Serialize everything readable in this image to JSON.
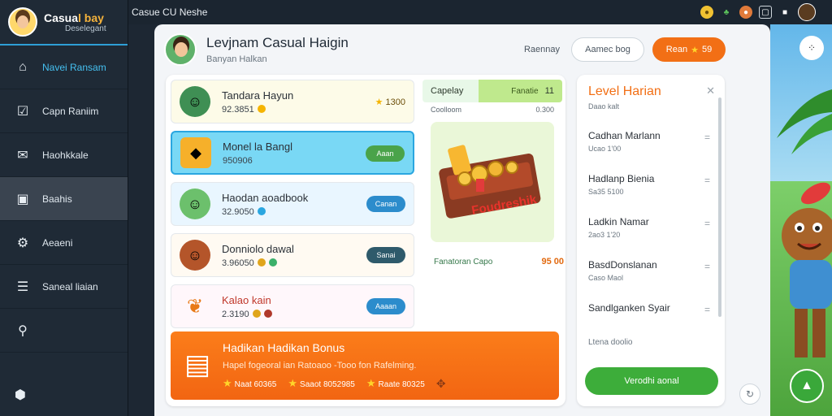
{
  "app": {
    "brand_name_1": "Casua",
    "brand_name_2": "l bay",
    "brand_sub": "Deselegant",
    "window_title": "Casue CU Neshe"
  },
  "sidebar": {
    "items": [
      {
        "label": "Navei Ransam",
        "icon": "home-icon"
      },
      {
        "label": "Capn Raniim",
        "icon": "checklist-icon"
      },
      {
        "label": "Haohkkale",
        "icon": "mail-icon"
      },
      {
        "label": "Baahis",
        "icon": "bag-icon"
      },
      {
        "label": "Aeaeni",
        "icon": "gear-icon"
      },
      {
        "label": "Saneal liaian",
        "icon": "list-icon"
      }
    ],
    "search_icon": "search-icon",
    "bottom_icon": "box-icon"
  },
  "header": {
    "user_name": "Levjnam Casual Haigin",
    "user_sub": "Banyan Halkan",
    "link": "Raennay",
    "outline_button": "Aamec bog",
    "orange_button": "Rean",
    "orange_value": "59"
  },
  "quests": [
    {
      "title": "Tandara Hayun",
      "value": "92.3851",
      "reward": "1300",
      "icon": "avatar-icon",
      "bg": "#fdfbe8"
    },
    {
      "title": "Monel la Bangl",
      "value": "950906",
      "button": "Aaan",
      "button_color": "#4aa34a",
      "icon": "gold-icon",
      "bg": "#79d8f5"
    },
    {
      "title": "Haodan aoadbook",
      "value": "32.9050",
      "button": "Canan",
      "button_color": "#2c8ccc",
      "icon": "avatar-icon",
      "bg": "#e9f6ff"
    },
    {
      "title": "Donniolo dawal",
      "value": "3.96050",
      "button": "Sanai",
      "button_color": "#2e5a6b",
      "icon": "avatar-icon",
      "bg": "#fffaf2"
    },
    {
      "title": "Kalao kain",
      "value": "2.3190",
      "button": "Aaaan",
      "button_color": "#2c8ccc",
      "icon": "fruit-icon",
      "bg": "#fff7fb"
    }
  ],
  "chest": {
    "title": "Capelay",
    "title_right": "Fanatie",
    "title_num": "11",
    "sub_left": "Coolloom",
    "sub_right": "0.300",
    "art_label": "Foudreshik",
    "foot_label": "Fanatoran Capo",
    "foot_value": "95 00"
  },
  "bonus": {
    "title": "Hadikan Hadikan Bonus",
    "desc": "Hapel fogeoral ian Ratoaoo -Tooo fon Rafelming.",
    "items": [
      "Naat 60365",
      "Saaot 8052985",
      "Raate 80325"
    ]
  },
  "level": {
    "title": "Level Harian",
    "sub": "Daao kalt",
    "items": [
      {
        "name": "Cadhan Marlann",
        "sub": "Ucao 1'00"
      },
      {
        "name": "Hadlanp Bienia",
        "sub": "Sa35 5100"
      },
      {
        "name": "Ladkin Namar",
        "sub": "2ao3 1'20"
      },
      {
        "name": "BasdDonslanan",
        "sub": "Caso Maol"
      },
      {
        "name": "Sandlganken Syair",
        "sub": ""
      }
    ],
    "footer": "Ltena doolio",
    "button": "Verodhi aonal"
  },
  "colors": {
    "accent_orange": "#f26f15",
    "accent_green": "#3dad3a",
    "sidebar_bg": "#1f2a36",
    "active_blue": "#45c0f0"
  }
}
